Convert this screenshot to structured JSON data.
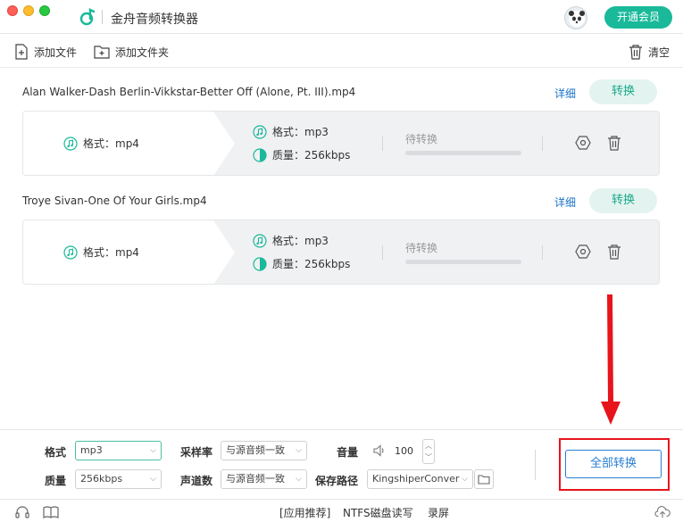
{
  "window": {
    "title": "金舟音频转换器"
  },
  "header": {
    "vip_label": "开通会员"
  },
  "toolbar": {
    "add_file": "添加文件",
    "add_folder": "添加文件夹",
    "clear": "清空"
  },
  "files": [
    {
      "name": "Alan Walker-Dash Berlin-Vikkstar-Better Off (Alone, Pt. III).mp4",
      "detail_label": "详细",
      "convert_label": "转换",
      "source_format": "格式：mp4",
      "target_format": "格式：mp3",
      "target_quality": "质量：256kbps",
      "status": "待转换",
      "progress": 0
    },
    {
      "name": "Troye Sivan-One Of Your Girls.mp4",
      "detail_label": "详细",
      "convert_label": "转换",
      "source_format": "格式：mp4",
      "target_format": "格式：mp3",
      "target_quality": "质量：256kbps",
      "status": "待转换",
      "progress": 0
    }
  ],
  "settings": {
    "format_label": "格式",
    "format_value": "mp3",
    "quality_label": "质量",
    "quality_value": "256kbps",
    "sample_rate_label": "采样率",
    "sample_rate_value": "与源音频一致",
    "channels_label": "声道数",
    "channels_value": "与源音频一致",
    "volume_label": "音量",
    "volume_value": "100",
    "save_path_label": "保存路径",
    "save_path_value": "KingshiperConver",
    "convert_all_label": "全部转换"
  },
  "footer": {
    "app_recommend": "[应用推荐]",
    "ntfs": "NTFS磁盘读写",
    "record": "录屏"
  },
  "colors": {
    "accent": "#19b99a",
    "link": "#1a73c7",
    "button_blue": "#2a7fd4",
    "annotation_red": "#e8141b"
  }
}
